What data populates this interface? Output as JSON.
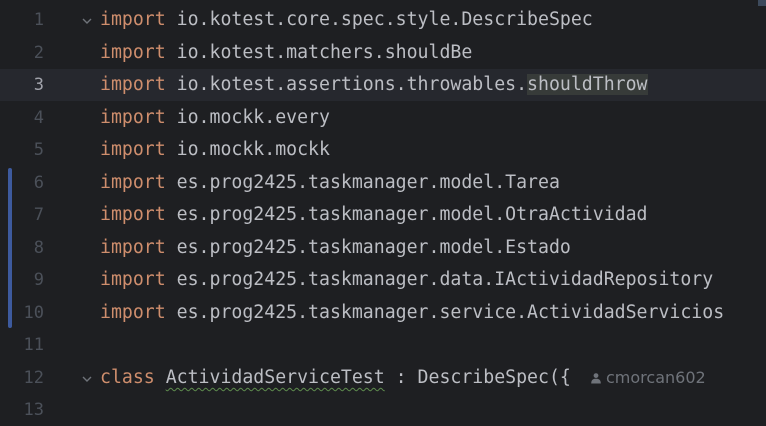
{
  "editor": {
    "current_line": 3,
    "colors": {
      "background": "#1e1f22",
      "keyword": "#cf8e6d",
      "text": "#bcbec4",
      "line_number": "#4b5059",
      "vcs_modified": "#3d5a9e"
    },
    "lines": [
      {
        "num": "1",
        "kw": "import",
        "rest": " io.kotest.core.spec.style.DescribeSpec"
      },
      {
        "num": "2",
        "kw": "import",
        "rest": " io.kotest.matchers.shouldBe"
      },
      {
        "num": "3",
        "kw": "import",
        "rest": " io.kotest.assertions.throwables.",
        "highlight": "shouldThrow"
      },
      {
        "num": "4",
        "kw": "import",
        "rest": " io.mockk.every"
      },
      {
        "num": "5",
        "kw": "import",
        "rest": " io.mockk.mockk"
      },
      {
        "num": "6",
        "kw": "import",
        "rest": " es.prog2425.taskmanager.model.Tarea"
      },
      {
        "num": "7",
        "kw": "import",
        "rest": " es.prog2425.taskmanager.model.OtraActividad"
      },
      {
        "num": "8",
        "kw": "import",
        "rest": " es.prog2425.taskmanager.model.Estado"
      },
      {
        "num": "9",
        "kw": "import",
        "rest": " es.prog2425.taskmanager.data.IActividadRepository"
      },
      {
        "num": "10",
        "kw": "import",
        "rest": " es.prog2425.taskmanager.service.ActividadServicios"
      },
      {
        "num": "11",
        "kw": "",
        "rest": ""
      },
      {
        "num": "12",
        "kw": "class",
        "rest": " ",
        "classname": "ActividadServiceTest",
        "tail": " : DescribeSpec({"
      },
      {
        "num": "13",
        "kw": "",
        "rest": ""
      }
    ],
    "author_hint": "cmorcan602",
    "icons": {
      "fold": "chevron-down-icon",
      "author": "user-icon"
    }
  }
}
